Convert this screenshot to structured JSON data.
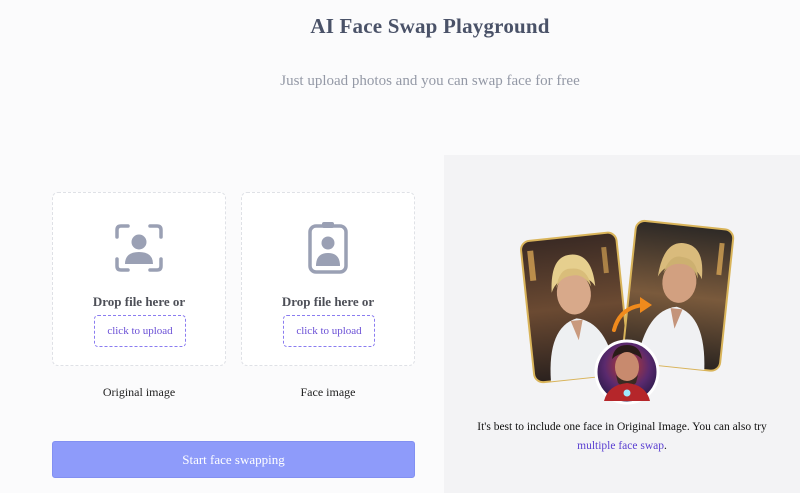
{
  "header": {
    "title": "AI Face Swap Playground",
    "subtitle": "Just upload photos and you can swap face for free"
  },
  "upload": {
    "original": {
      "icon": "face-scan-icon",
      "drop_text": "Drop file here or",
      "button_label": "click to upload",
      "caption": "Original image"
    },
    "face": {
      "icon": "portrait-card-icon",
      "drop_text": "Drop file here or",
      "button_label": "click to upload",
      "caption": "Face image"
    }
  },
  "actions": {
    "start_label": "Start face swapping"
  },
  "example": {
    "tip_text": "It's best to include one face in Original Image. You can also try",
    "tip_link": "multiple face swap",
    "tip_end": "."
  },
  "colors": {
    "accent": "#8e9bfa",
    "link": "#5a3fd1",
    "icon": "#9aa0b4",
    "arrow": "#f08a1c"
  }
}
